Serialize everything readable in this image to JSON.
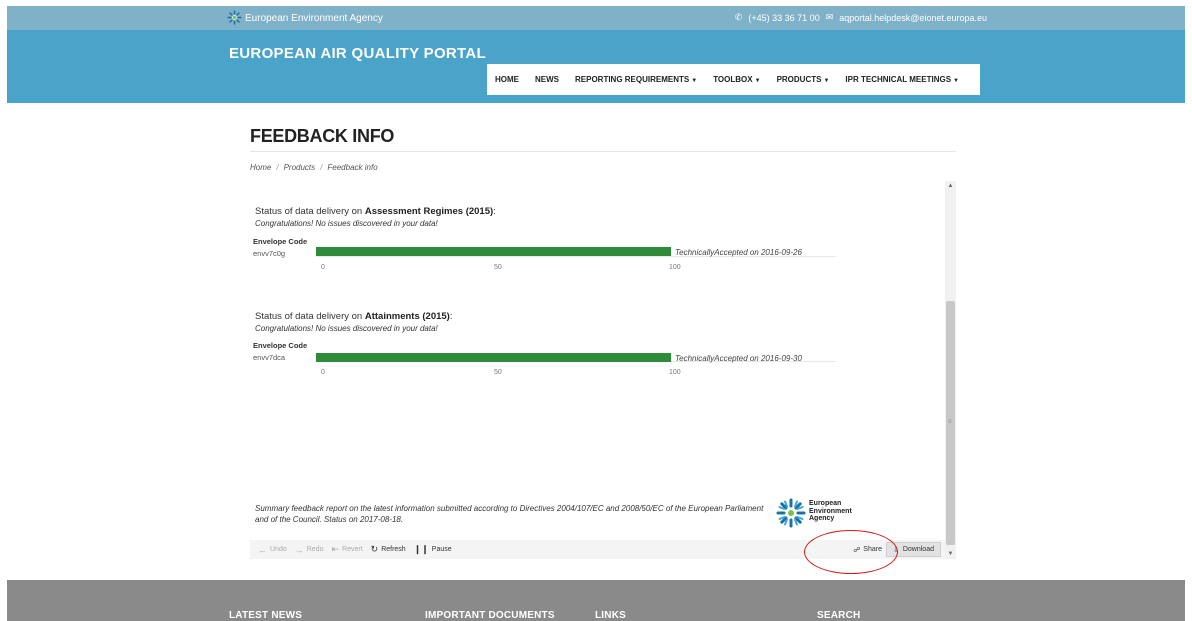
{
  "topbar": {
    "agency_name": "European Environment Agency",
    "phone": "(+45) 33 36 71 00",
    "email": "aqportal.helpdesk@eionet.europa.eu"
  },
  "header": {
    "portal_title": "EUROPEAN AIR QUALITY PORTAL",
    "nav": [
      {
        "label": "HOME",
        "dropdown": false
      },
      {
        "label": "NEWS",
        "dropdown": false
      },
      {
        "label": "REPORTING REQUIREMENTS",
        "dropdown": true
      },
      {
        "label": "TOOLBOX",
        "dropdown": true
      },
      {
        "label": "PRODUCTS",
        "dropdown": true
      },
      {
        "label": "IPR TECHNICAL MEETINGS",
        "dropdown": true
      }
    ]
  },
  "page": {
    "title": "FEEDBACK INFO",
    "breadcrumb": [
      "Home",
      "Products",
      "Feedback info"
    ],
    "breadcrumb_sep": "/"
  },
  "viz": {
    "sections": [
      {
        "heading_prefix": "Status of data delivery on ",
        "heading_bold": "Assessment Regimes (2015)",
        "heading_suffix": ":",
        "subtitle": "Congratulations! No issues discovered in your data!",
        "envelope_label": "Envelope Code",
        "envelope_code": "envv7c0g",
        "progress_percent": 100,
        "status": "TechnicallyAccepted on 2016-09-26",
        "ticks": [
          "0",
          "50",
          "100"
        ]
      },
      {
        "heading_prefix": "Status of data delivery on ",
        "heading_bold": "Attainments (2015)",
        "heading_suffix": ":",
        "subtitle": "Congratulations! No issues discovered in your data!",
        "envelope_label": "Envelope Code",
        "envelope_code": "envv7dca",
        "progress_percent": 100,
        "status": "TechnicallyAccepted on 2016-09-30",
        "ticks": [
          "0",
          "50",
          "100"
        ]
      }
    ],
    "summary": "Summary feedback report on the latest information submitted according to Directives 2004/107/EC and 2008/50/EC of the European Parliament and of the Council. Status on 2017-08-18.",
    "logo_text": [
      "European",
      "Environment",
      "Agency"
    ],
    "bar_color": "#2e8b3a"
  },
  "toolbar": {
    "undo": "Undo",
    "redo": "Redo",
    "revert": "Revert",
    "refresh": "Refresh",
    "pause": "Pause",
    "share": "Share",
    "download": "Download"
  },
  "footer": {
    "columns": [
      "LATEST NEWS",
      "IMPORTANT DOCUMENTS",
      "LINKS",
      "SEARCH"
    ]
  },
  "colors": {
    "topbar": "#7fb1c9",
    "header": "#4aa3c8",
    "footer": "#8a8a8a",
    "annotation": "#d01a1a"
  }
}
